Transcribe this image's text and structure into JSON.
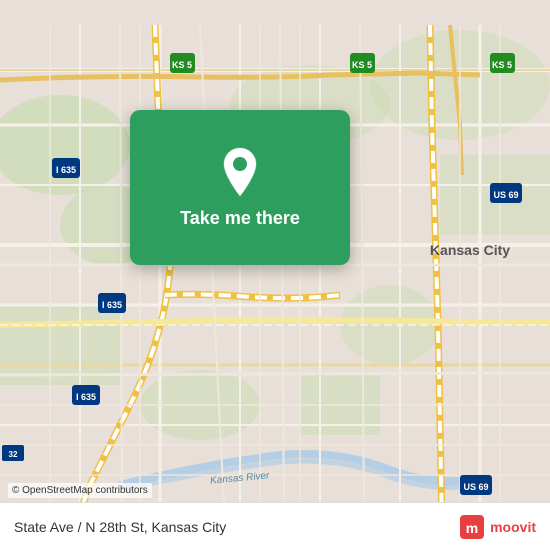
{
  "map": {
    "background_color": "#e8e0d8",
    "center_label": "State Ave / N 28th St, Kansas City",
    "city_label": "Kansas City",
    "attribution": "© OpenStreetMap contributors"
  },
  "card": {
    "label": "Take me there",
    "pin_color": "#ffffff"
  },
  "bottom_bar": {
    "location": "State Ave / N 28th St, Kansas City",
    "logo_text": "moovit"
  },
  "highway_labels": {
    "i635_top": "I 635",
    "i635_mid": "I 635",
    "i635_bot": "I 635",
    "ks5_left": "KS 5",
    "ks5_right": "KS 5",
    "ks5_far": "KS 5",
    "us69_top": "US 69",
    "us69_bot": "US 69",
    "kansas_river": "Kansas River"
  }
}
